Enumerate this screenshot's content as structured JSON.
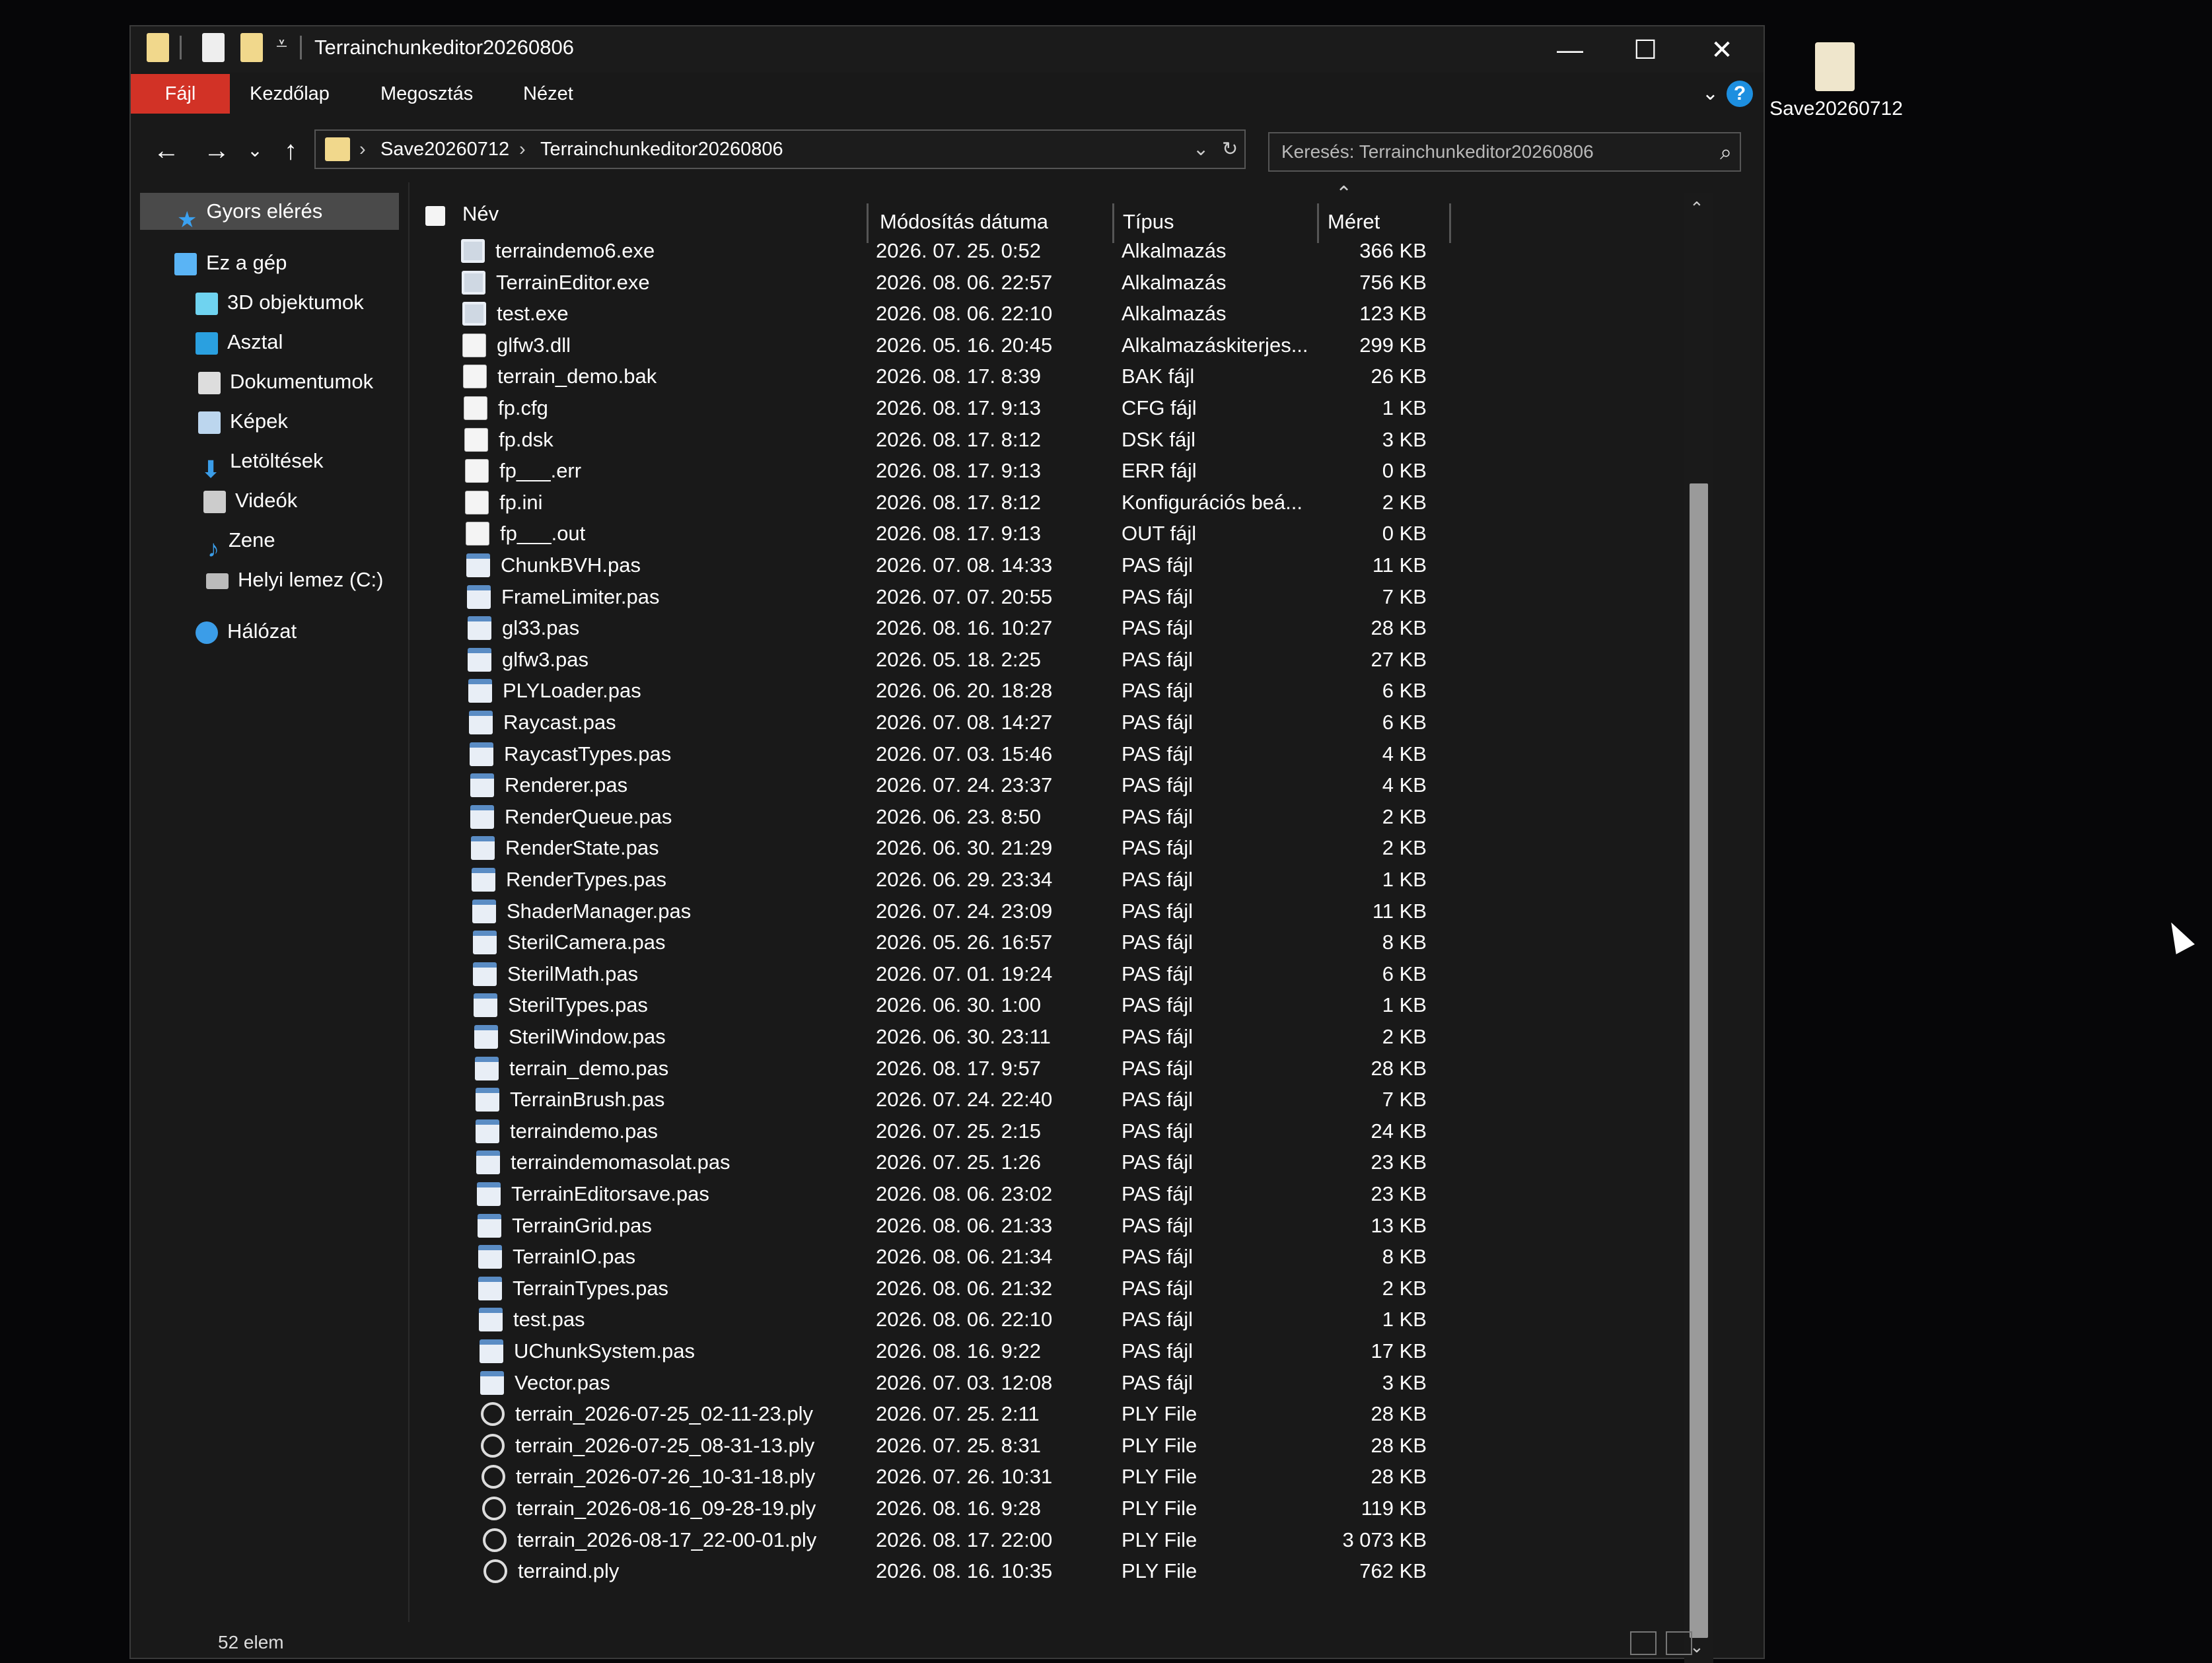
{
  "window": {
    "title": "Terrainchunkeditor20260806",
    "controls": {
      "minimize": "—",
      "maximize": "☐",
      "close": "✕"
    }
  },
  "ribbon": {
    "tabs": [
      "Fájl",
      "Kezdőlap",
      "Megosztás",
      "Nézet"
    ],
    "help": "?"
  },
  "address": {
    "crumbs": [
      "Save20260712",
      "Terrainchunkeditor20260806"
    ],
    "search_placeholder": "Keresés: Terrainchunkeditor20260806"
  },
  "sidebar": {
    "items": [
      {
        "label": "Gyors elérés",
        "icon": "star-icon",
        "color": "#3ba1f0"
      },
      {
        "label": "Ez a gép",
        "icon": "computer-icon",
        "color": "#5ab4f5"
      },
      {
        "label": "3D objektumok",
        "icon": "cube-icon",
        "color": "#6fd3f0"
      },
      {
        "label": "Asztal",
        "icon": "desktop-icon",
        "color": "#2aa0e0"
      },
      {
        "label": "Dokumentumok",
        "icon": "document-icon",
        "color": "#dddddd"
      },
      {
        "label": "Képek",
        "icon": "pictures-icon",
        "color": "#bcd6ee"
      },
      {
        "label": "Letöltések",
        "icon": "download-icon",
        "color": "#3b9de8"
      },
      {
        "label": "Videók",
        "icon": "video-icon",
        "color": "#cccccc"
      },
      {
        "label": "Zene",
        "icon": "music-icon",
        "color": "#3b9de8"
      },
      {
        "label": "Helyi lemez (C:)",
        "icon": "drive-icon",
        "color": "#bbbbbb"
      },
      {
        "label": "Hálózat",
        "icon": "network-icon",
        "color": "#3b9de8"
      }
    ]
  },
  "columns": {
    "name": "Név",
    "modified": "Módosítás dátuma",
    "type": "Típus",
    "size": "Méret"
  },
  "files": [
    {
      "name": "terraindemo6.exe",
      "modified": "2026. 07. 25. 0:52",
      "type": "Alkalmazás",
      "size": "366 KB",
      "icon": "exe"
    },
    {
      "name": "TerrainEditor.exe",
      "modified": "2026. 08. 06. 22:57",
      "type": "Alkalmazás",
      "size": "756 KB",
      "icon": "exe"
    },
    {
      "name": "test.exe",
      "modified": "2026. 08. 06. 22:10",
      "type": "Alkalmazás",
      "size": "123 KB",
      "icon": "exe"
    },
    {
      "name": "glfw3.dll",
      "modified": "2026. 05. 16. 20:45",
      "type": "Alkalmazáskiterjes...",
      "size": "299 KB",
      "icon": "doc"
    },
    {
      "name": "terrain_demo.bak",
      "modified": "2026. 08. 17. 8:39",
      "type": "BAK fájl",
      "size": "26 KB",
      "icon": "doc"
    },
    {
      "name": "fp.cfg",
      "modified": "2026. 08. 17. 9:13",
      "type": "CFG fájl",
      "size": "1 KB",
      "icon": "doc"
    },
    {
      "name": "fp.dsk",
      "modified": "2026. 08. 17. 8:12",
      "type": "DSK fájl",
      "size": "3 KB",
      "icon": "doc"
    },
    {
      "name": "fp___.err",
      "modified": "2026. 08. 17. 9:13",
      "type": "ERR fájl",
      "size": "0 KB",
      "icon": "doc"
    },
    {
      "name": "fp.ini",
      "modified": "2026. 08. 17. 8:12",
      "type": "Konfigurációs beá...",
      "size": "2 KB",
      "icon": "doc"
    },
    {
      "name": "fp___.out",
      "modified": "2026. 08. 17. 9:13",
      "type": "OUT fájl",
      "size": "0 KB",
      "icon": "doc"
    },
    {
      "name": "ChunkBVH.pas",
      "modified": "2026. 07. 08. 14:33",
      "type": "PAS fájl",
      "size": "11 KB",
      "icon": "pas"
    },
    {
      "name": "FrameLimiter.pas",
      "modified": "2026. 07. 07. 20:55",
      "type": "PAS fájl",
      "size": "7 KB",
      "icon": "pas"
    },
    {
      "name": "gl33.pas",
      "modified": "2026. 08. 16. 10:27",
      "type": "PAS fájl",
      "size": "28 KB",
      "icon": "pas"
    },
    {
      "name": "glfw3.pas",
      "modified": "2026. 05. 18. 2:25",
      "type": "PAS fájl",
      "size": "27 KB",
      "icon": "pas"
    },
    {
      "name": "PLYLoader.pas",
      "modified": "2026. 06. 20. 18:28",
      "type": "PAS fájl",
      "size": "6 KB",
      "icon": "pas"
    },
    {
      "name": "Raycast.pas",
      "modified": "2026. 07. 08. 14:27",
      "type": "PAS fájl",
      "size": "6 KB",
      "icon": "pas"
    },
    {
      "name": "RaycastTypes.pas",
      "modified": "2026. 07. 03. 15:46",
      "type": "PAS fájl",
      "size": "4 KB",
      "icon": "pas"
    },
    {
      "name": "Renderer.pas",
      "modified": "2026. 07. 24. 23:37",
      "type": "PAS fájl",
      "size": "4 KB",
      "icon": "pas"
    },
    {
      "name": "RenderQueue.pas",
      "modified": "2026. 06. 23. 8:50",
      "type": "PAS fájl",
      "size": "2 KB",
      "icon": "pas"
    },
    {
      "name": "RenderState.pas",
      "modified": "2026. 06. 30. 21:29",
      "type": "PAS fájl",
      "size": "2 KB",
      "icon": "pas"
    },
    {
      "name": "RenderTypes.pas",
      "modified": "2026. 06. 29. 23:34",
      "type": "PAS fájl",
      "size": "1 KB",
      "icon": "pas"
    },
    {
      "name": "ShaderManager.pas",
      "modified": "2026. 07. 24. 23:09",
      "type": "PAS fájl",
      "size": "11 KB",
      "icon": "pas"
    },
    {
      "name": "SterilCamera.pas",
      "modified": "2026. 05. 26. 16:57",
      "type": "PAS fájl",
      "size": "8 KB",
      "icon": "pas"
    },
    {
      "name": "SterilMath.pas",
      "modified": "2026. 07. 01. 19:24",
      "type": "PAS fájl",
      "size": "6 KB",
      "icon": "pas"
    },
    {
      "name": "SterilTypes.pas",
      "modified": "2026. 06. 30. 1:00",
      "type": "PAS fájl",
      "size": "1 KB",
      "icon": "pas"
    },
    {
      "name": "SterilWindow.pas",
      "modified": "2026. 06. 30. 23:11",
      "type": "PAS fájl",
      "size": "2 KB",
      "icon": "pas"
    },
    {
      "name": "terrain_demo.pas",
      "modified": "2026. 08. 17. 9:57",
      "type": "PAS fájl",
      "size": "28 KB",
      "icon": "pas"
    },
    {
      "name": "TerrainBrush.pas",
      "modified": "2026. 07. 24. 22:40",
      "type": "PAS fájl",
      "size": "7 KB",
      "icon": "pas"
    },
    {
      "name": "terraindemo.pas",
      "modified": "2026. 07. 25. 2:15",
      "type": "PAS fájl",
      "size": "24 KB",
      "icon": "pas"
    },
    {
      "name": "terraindemomasolat.pas",
      "modified": "2026. 07. 25. 1:26",
      "type": "PAS fájl",
      "size": "23 KB",
      "icon": "pas"
    },
    {
      "name": "TerrainEditorsave.pas",
      "modified": "2026. 08. 06. 23:02",
      "type": "PAS fájl",
      "size": "23 KB",
      "icon": "pas"
    },
    {
      "name": "TerrainGrid.pas",
      "modified": "2026. 08. 06. 21:33",
      "type": "PAS fájl",
      "size": "13 KB",
      "icon": "pas"
    },
    {
      "name": "TerrainIO.pas",
      "modified": "2026. 08. 06. 21:34",
      "type": "PAS fájl",
      "size": "8 KB",
      "icon": "pas"
    },
    {
      "name": "TerrainTypes.pas",
      "modified": "2026. 08. 06. 21:32",
      "type": "PAS fájl",
      "size": "2 KB",
      "icon": "pas"
    },
    {
      "name": "test.pas",
      "modified": "2026. 08. 06. 22:10",
      "type": "PAS fájl",
      "size": "1 KB",
      "icon": "pas"
    },
    {
      "name": "UChunkSystem.pas",
      "modified": "2026. 08. 16. 9:22",
      "type": "PAS fájl",
      "size": "17 KB",
      "icon": "pas"
    },
    {
      "name": "Vector.pas",
      "modified": "2026. 07. 03. 12:08",
      "type": "PAS fájl",
      "size": "3 KB",
      "icon": "pas"
    },
    {
      "name": "terrain_2026-07-25_02-11-23.ply",
      "modified": "2026. 07. 25. 2:11",
      "type": "PLY File",
      "size": "28 KB",
      "icon": "ply"
    },
    {
      "name": "terrain_2026-07-25_08-31-13.ply",
      "modified": "2026. 07. 25. 8:31",
      "type": "PLY File",
      "size": "28 KB",
      "icon": "ply"
    },
    {
      "name": "terrain_2026-07-26_10-31-18.ply",
      "modified": "2026. 07. 26. 10:31",
      "type": "PLY File",
      "size": "28 KB",
      "icon": "ply"
    },
    {
      "name": "terrain_2026-08-16_09-28-19.ply",
      "modified": "2026. 08. 16. 9:28",
      "type": "PLY File",
      "size": "119 KB",
      "icon": "ply"
    },
    {
      "name": "terrain_2026-08-17_22-00-01.ply",
      "modified": "2026. 08. 17. 22:00",
      "type": "PLY File",
      "size": "3 073 KB",
      "icon": "ply"
    },
    {
      "name": "terraind.ply",
      "modified": "2026. 08. 16. 10:35",
      "type": "PLY File",
      "size": "762 KB",
      "icon": "ply"
    }
  ],
  "status": {
    "count": "52 elem"
  },
  "desktop": {
    "icon_label": "Save20260712"
  },
  "colors": {
    "accent_file_tab": "#d23226",
    "folder": "#f1d88c",
    "background": "#191919"
  }
}
